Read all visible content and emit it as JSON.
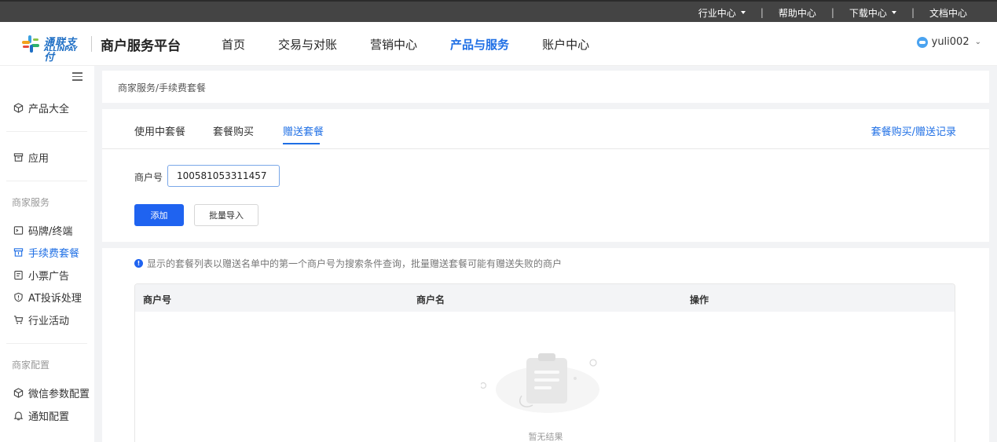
{
  "topbar": {
    "links": [
      {
        "label": "行业中心",
        "dropdown": true
      },
      {
        "label": "帮助中心",
        "dropdown": false
      },
      {
        "label": "下载中心",
        "dropdown": true
      },
      {
        "label": "文档中心",
        "dropdown": false
      }
    ],
    "separator": "|"
  },
  "header": {
    "logo_text": "通联支付",
    "logo_subtext": "ALLINPAY",
    "platform_title": "商户服务平台",
    "nav": [
      {
        "label": "首页",
        "active": false
      },
      {
        "label": "交易与对账",
        "active": false
      },
      {
        "label": "营销中心",
        "active": false
      },
      {
        "label": "产品与服务",
        "active": true
      },
      {
        "label": "账户中心",
        "active": false
      }
    ],
    "username": "yuli002"
  },
  "sidebar": {
    "items_top": [
      {
        "label": "产品大全",
        "icon": "cube-icon"
      },
      {
        "label": "应用",
        "icon": "box-icon"
      }
    ],
    "group_merchant_service": "商家服务",
    "merchant_service_items": [
      {
        "label": "码牌/终端",
        "icon": "terminal-icon",
        "active": false
      },
      {
        "label": "手续费套餐",
        "icon": "package-icon",
        "active": true
      },
      {
        "label": "小票广告",
        "icon": "receipt-icon",
        "active": false
      },
      {
        "label": "AT投诉处理",
        "icon": "shield-icon",
        "active": false
      },
      {
        "label": "行业活动",
        "icon": "cart-icon",
        "active": false
      }
    ],
    "group_merchant_config": "商家配置",
    "merchant_config_items": [
      {
        "label": "微信参数配置",
        "icon": "cube-icon"
      },
      {
        "label": "通知配置",
        "icon": "bell-icon"
      }
    ]
  },
  "breadcrumb": "商家服务/手续费套餐",
  "tabs": [
    {
      "label": "使用中套餐",
      "active": false
    },
    {
      "label": "套餐购买",
      "active": false
    },
    {
      "label": "赠送套餐",
      "active": true
    }
  ],
  "record_link": "套餐购买/赠送记录",
  "form": {
    "merchant_label": "商户号",
    "merchant_value": "100581053311457",
    "add_button": "添加",
    "import_button": "批量导入"
  },
  "notice": "显示的套餐列表以赠送名单中的第一个商户号为搜索条件查询，批量赠送套餐可能有赠送失败的商户",
  "table": {
    "columns": [
      "商户号",
      "商户名",
      "操作"
    ],
    "empty_text": "暂无结果"
  },
  "colors": {
    "accent": "#1f6fe5",
    "primary_button": "#1f63f0",
    "topbar_bg": "#444444"
  }
}
